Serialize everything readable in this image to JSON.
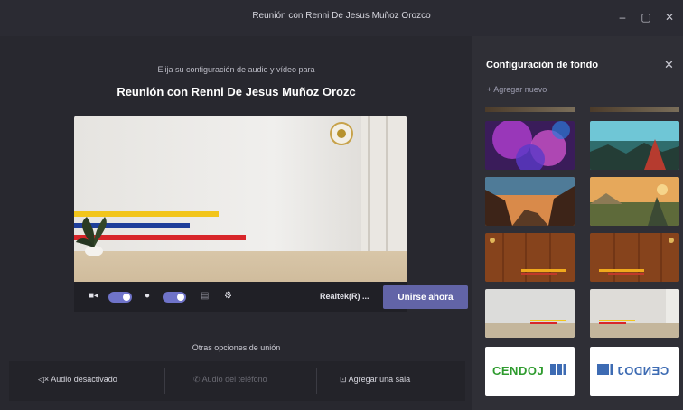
{
  "window": {
    "title": "Reunión con Renni De Jesus Muñoz Orozco",
    "minimize_glyph": "–",
    "maximize_glyph": "▢",
    "close_glyph": "✕"
  },
  "prejoin": {
    "subtitle": "Elija su configuración de audio y vídeo para",
    "meeting_title": "Reunión con Renni De Jesus Muñoz Orozc",
    "camera_on": true,
    "mic_on": true,
    "device_label": "Realtek(R) ...",
    "join_button": "Unirse ahora",
    "other_options_label": "Otras opciones de unión",
    "options": [
      {
        "label": "Audio desactivado",
        "icon": "speaker-off-icon",
        "enabled": true
      },
      {
        "label": "Audio del teléfono",
        "icon": "phone-icon",
        "enabled": false
      },
      {
        "label": "Agregar una sala",
        "icon": "room-icon",
        "enabled": true
      }
    ]
  },
  "sidebar": {
    "title": "Configuración de fondo",
    "close_glyph": "✕",
    "add_new": "+ Agregar nuevo",
    "thumbnails": [
      {
        "name": "bg-purple-abstract",
        "selected": false
      },
      {
        "name": "bg-landscape-teal",
        "selected": false
      },
      {
        "name": "bg-sunset-canyon",
        "selected": false
      },
      {
        "name": "bg-fantasy-valley",
        "selected": false
      },
      {
        "name": "bg-wood-wall-left",
        "selected": false
      },
      {
        "name": "bg-wood-wall-right",
        "selected": false
      },
      {
        "name": "bg-white-room-left",
        "selected": false
      },
      {
        "name": "bg-white-room-right",
        "selected": false
      },
      {
        "name": "bg-cendoj-logo",
        "selected": false,
        "logo_text": "CENDOJ"
      },
      {
        "name": "bg-cendoj-logo-mirrored",
        "selected": false,
        "logo_text": "CENDOJ"
      }
    ]
  },
  "colors": {
    "accent": "#6264a7",
    "flag_yellow": "#f2c51b",
    "flag_blue": "#1e3e9a",
    "flag_red": "#d8262a"
  }
}
